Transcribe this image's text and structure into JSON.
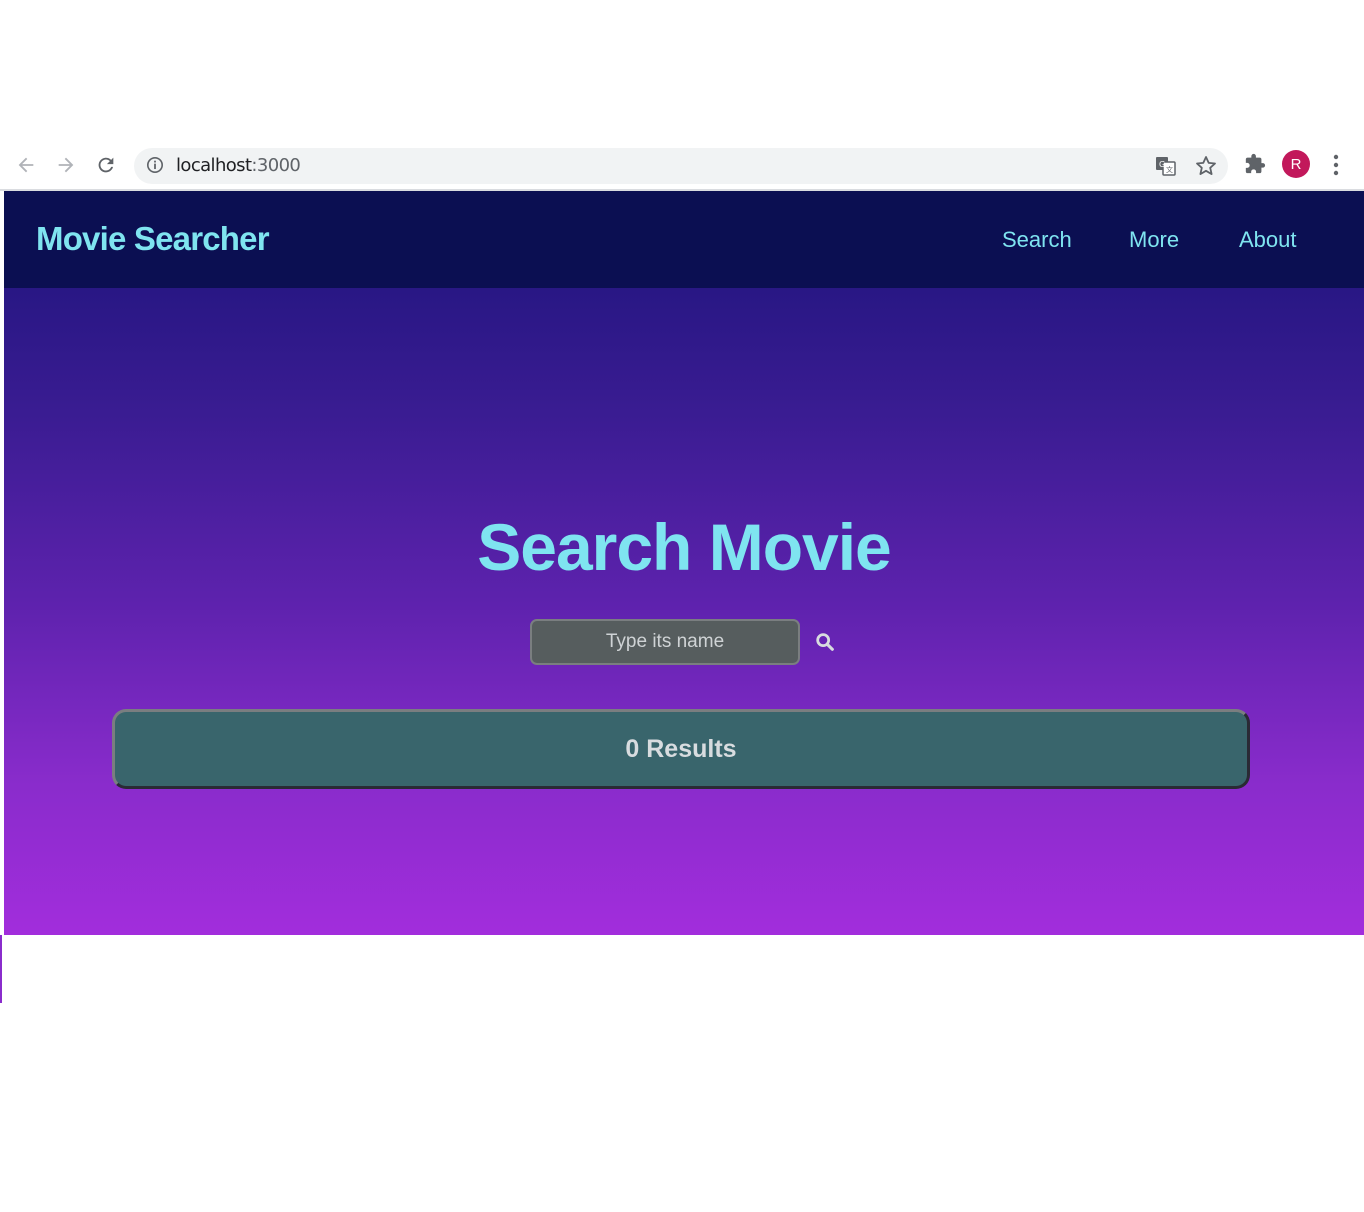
{
  "browser": {
    "url_host": "localhost",
    "url_port": ":3000",
    "profile_initial": "R"
  },
  "navbar": {
    "brand": "Movie Searcher",
    "links": [
      "Search",
      "More",
      "About"
    ]
  },
  "hero": {
    "title": "Search Movie"
  },
  "search": {
    "placeholder": "Type its name",
    "value": ""
  },
  "results": {
    "label": "0 Results"
  },
  "colors": {
    "navbar_bg": "#0b0f52",
    "accent": "#7fe4f0",
    "gradient_top": "#1b137a",
    "gradient_bottom": "#a22ddc",
    "results_bg": "#39656c",
    "avatar": "#c2185b"
  },
  "icons": [
    "back-arrow-icon",
    "forward-arrow-icon",
    "reload-icon",
    "info-icon",
    "translate-icon",
    "star-icon",
    "puzzle-icon",
    "menu-dots-icon",
    "search-icon"
  ]
}
